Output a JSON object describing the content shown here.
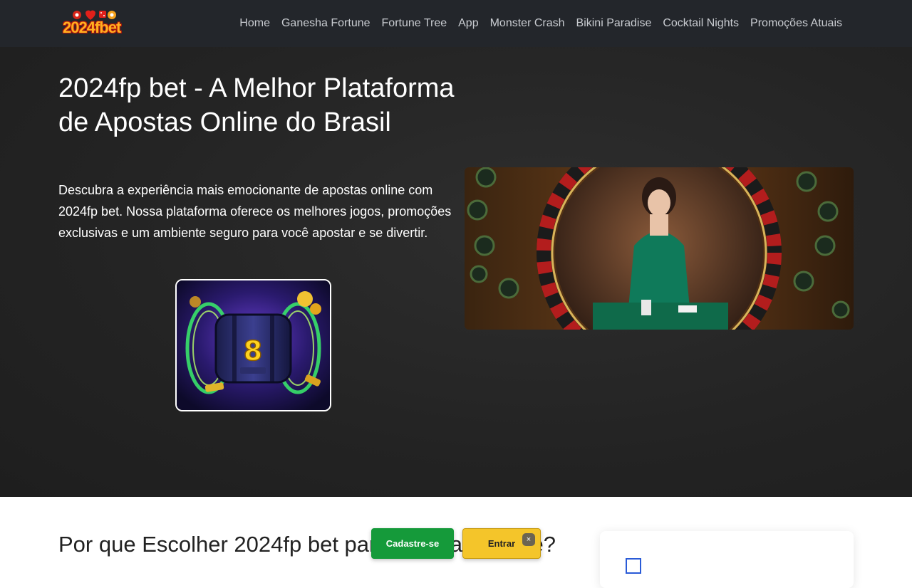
{
  "logo": {
    "text": "2024fbet"
  },
  "nav": {
    "links": [
      "Home",
      "Ganesha Fortune",
      "Fortune Tree",
      "App",
      "Monster Crash",
      "Bikini Paradise",
      "Cocktail Nights",
      "Promoções Atuais"
    ]
  },
  "hero": {
    "title": "2024fp bet - A Melhor Plataforma de Apostas Online do Brasil",
    "description": "Descubra a experiência mais emocionante de apostas online com 2024fp bet. Nossa plataforma oferece os melhores jogos, promoções exclusivas e um ambiente seguro para você apostar e se divertir."
  },
  "section": {
    "title": "Por que Escolher 2024fp bet para Apostas Online?"
  },
  "cta": {
    "register_label": "Cadastre-se",
    "login_label": "Entrar",
    "close_label": "×"
  },
  "icons": {
    "slot": "slot-machine-icon",
    "close": "close-icon"
  },
  "colors": {
    "nav_bg": "#23262b",
    "hero_bg": "#232323",
    "register_green": "#159a3a",
    "login_yellow": "#f4c52a"
  }
}
